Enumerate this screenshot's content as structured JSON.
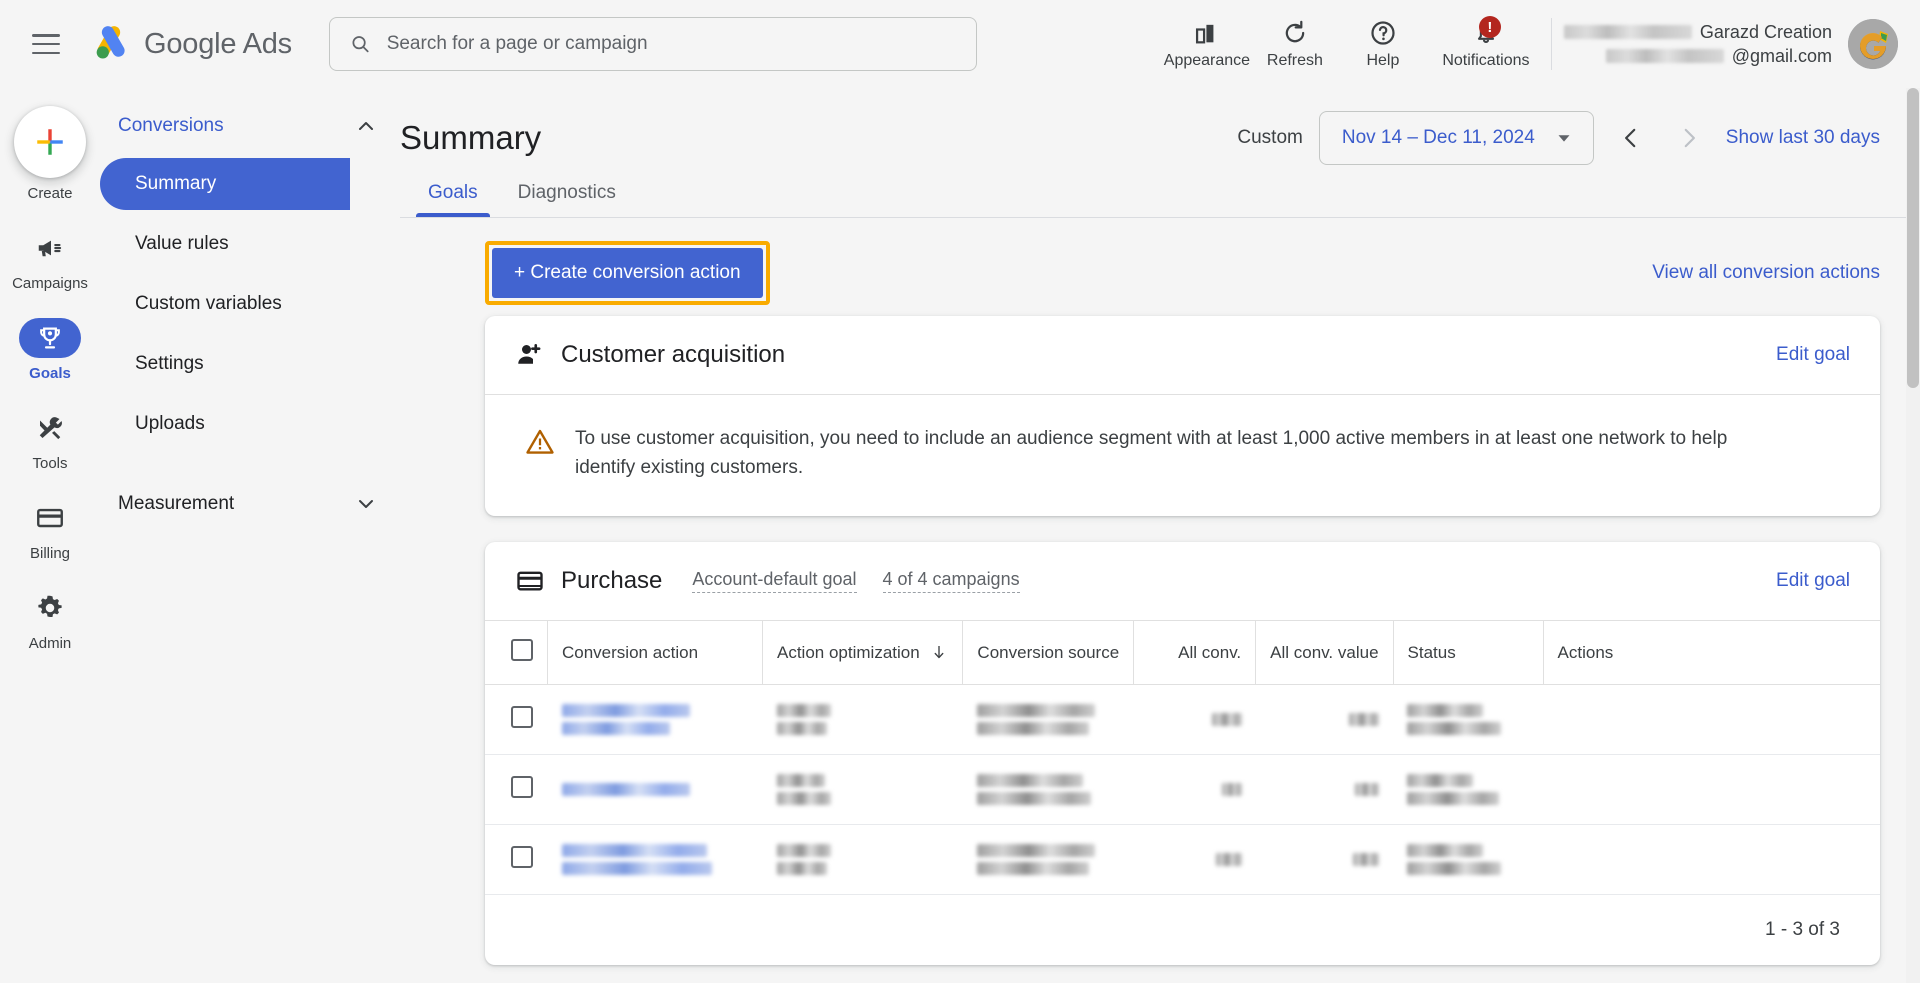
{
  "topbar": {
    "menu_icon": "hamburger-icon",
    "brand": "Google Ads",
    "search": {
      "placeholder": "Search for a page or campaign",
      "value": "",
      "icon": "search-icon"
    },
    "actions": [
      {
        "label": "Appearance",
        "icon": "appearance-icon"
      },
      {
        "label": "Refresh",
        "icon": "refresh-icon"
      },
      {
        "label": "Help",
        "icon": "help-icon"
      },
      {
        "label": "Notifications",
        "icon": "bell-icon",
        "badge": "!"
      }
    ],
    "account": {
      "name": "Garazd Creation",
      "email_suffix": "@gmail.com",
      "id_redacted": true,
      "email_redacted": true,
      "avatar": "account-avatar"
    }
  },
  "rail": {
    "create": {
      "label": "Create",
      "icon": "plus-icon"
    },
    "items": [
      {
        "label": "Campaigns",
        "icon": "megaphone-icon",
        "active": false
      },
      {
        "label": "Goals",
        "icon": "trophy-icon",
        "active": true
      },
      {
        "label": "Tools",
        "icon": "tools-icon",
        "active": false
      },
      {
        "label": "Billing",
        "icon": "credit-card-icon",
        "active": false
      },
      {
        "label": "Admin",
        "icon": "gear-icon",
        "active": false
      }
    ]
  },
  "subnav": {
    "section": "Conversions",
    "section_chevron": "chevron-up-icon",
    "items": [
      {
        "label": "Summary",
        "active": true
      },
      {
        "label": "Value rules",
        "active": false
      },
      {
        "label": "Custom variables",
        "active": false
      },
      {
        "label": "Settings",
        "active": false
      },
      {
        "label": "Uploads",
        "active": false
      }
    ],
    "group": {
      "label": "Measurement",
      "chevron": "chevron-down-icon"
    }
  },
  "page": {
    "title": "Summary",
    "daterange": {
      "custom_label": "Custom",
      "value": "Nov 14 – Dec 11, 2024",
      "dropdown_icon": "chevron-down-icon",
      "prev_icon": "chevron-left-icon",
      "next_icon": "chevron-right-icon",
      "shortcut": "Show last 30 days"
    },
    "tabs": [
      {
        "label": "Goals",
        "active": true
      },
      {
        "label": "Diagnostics",
        "active": false
      }
    ],
    "create_conversion_action": "+ Create conversion action",
    "view_all": "View all conversion actions"
  },
  "customer_acquisition": {
    "title": "Customer acquisition",
    "icon": "person-add-icon",
    "edit_goal": "Edit goal",
    "warning_icon": "warning-triangle-icon",
    "warning": "To use customer acquisition, you need to include an audience segment with at least 1,000 active members in at least one network to help identify existing customers."
  },
  "purchase": {
    "title": "Purchase",
    "icon": "card-icon",
    "sublinks": [
      "Account-default goal",
      "4 of 4 campaigns"
    ],
    "edit_goal": "Edit goal",
    "table": {
      "columns": [
        {
          "label": "Conversion action",
          "align": "left"
        },
        {
          "label": "Action optimization",
          "align": "left",
          "sort_icon": "arrow-down-icon"
        },
        {
          "label": "Conversion source",
          "align": "left"
        },
        {
          "label": "All conv.",
          "align": "right"
        },
        {
          "label": "All conv. value",
          "align": "right"
        },
        {
          "label": "Status",
          "align": "left"
        },
        {
          "label": "Actions",
          "align": "left"
        }
      ],
      "rows": [
        {
          "redacted": true,
          "conversion_action_lines": 2,
          "optimization_lines": 2,
          "source_lines": 2,
          "all_conv_lines": 1,
          "all_conv_value_lines": 1,
          "status_lines": 2
        },
        {
          "redacted": true,
          "conversion_action_lines": 1,
          "optimization_lines": 2,
          "source_lines": 2,
          "all_conv_lines": 1,
          "all_conv_value_lines": 1,
          "status_lines": 2
        },
        {
          "redacted": true,
          "conversion_action_lines": 2,
          "optimization_lines": 2,
          "source_lines": 2,
          "all_conv_lines": 1,
          "all_conv_value_lines": 1,
          "status_lines": 2
        }
      ],
      "footer": "1 - 3 of 3"
    }
  },
  "colors": {
    "brand_blue": "#4264d0",
    "link_blue": "#3b5ccc",
    "highlight_orange": "#f9ab00",
    "notification_red": "#b3261e",
    "page_bg": "#f5f5f5",
    "card_bg": "#ffffff",
    "warning_amber": "#b06000"
  }
}
